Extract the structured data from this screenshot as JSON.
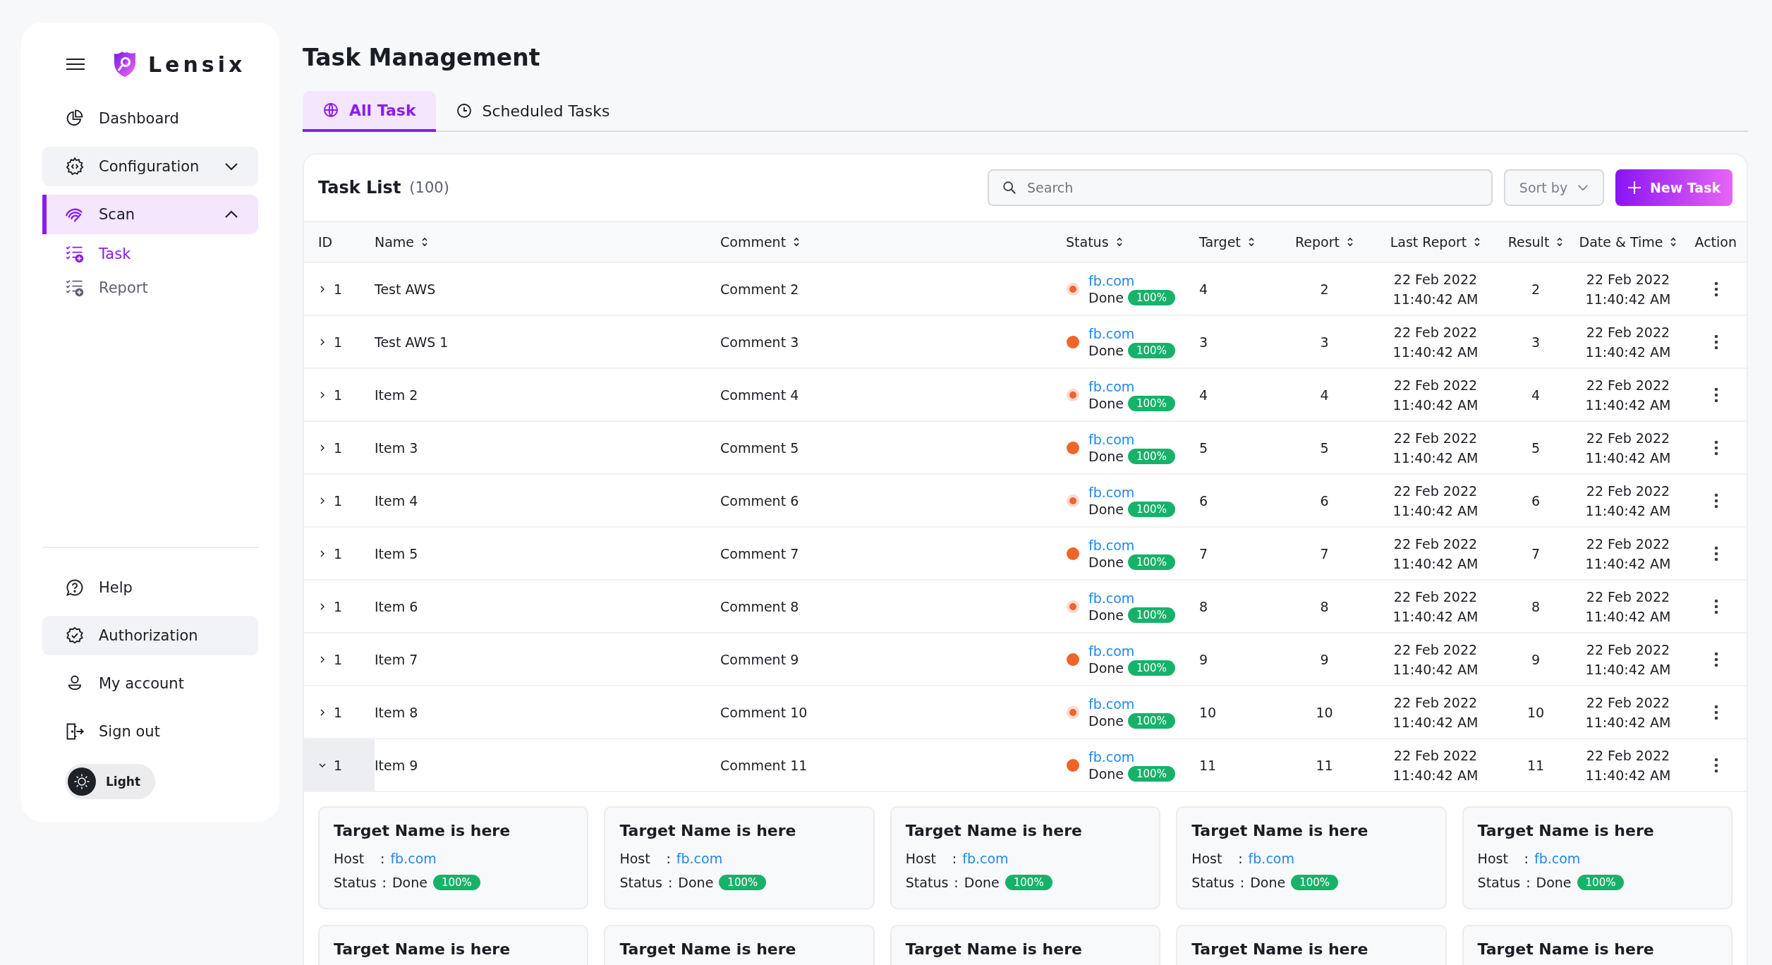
{
  "brand": "Lensix",
  "nav": [
    {
      "label": "Dashboard",
      "selected": false,
      "tinted": false
    },
    {
      "label": "Configuration",
      "selected": false,
      "expanded": false,
      "tinted": true
    },
    {
      "label": "Scan",
      "selected": true,
      "expanded": true,
      "children": [
        {
          "label": "Task",
          "selected": true
        },
        {
          "label": "Report",
          "selected": false
        }
      ]
    }
  ],
  "bottom_nav": [
    {
      "label": "Help",
      "tinted": false
    },
    {
      "label": "Authorization",
      "tinted": true
    },
    {
      "label": "My account",
      "tinted": false
    },
    {
      "label": "Sign out",
      "tinted": false
    }
  ],
  "theme_toggle": {
    "label": "Light",
    "on": false
  },
  "page_title": "Task Management",
  "tabs": [
    {
      "label": "All Task",
      "selected": true
    },
    {
      "label": "Scheduled Tasks",
      "selected": false
    }
  ],
  "task_list": {
    "title": "Task List",
    "count": "(100)",
    "search": {
      "placeholder": "Search"
    },
    "sort": {
      "placeholder": "Sort by"
    },
    "new_button": "New Task"
  },
  "columns": [
    {
      "label": "ID",
      "sortable": false
    },
    {
      "label": "Name",
      "sortable": true
    },
    {
      "label": "Comment",
      "sortable": true
    },
    {
      "label": "Status",
      "sortable": true
    },
    {
      "label": "Target",
      "sortable": true
    },
    {
      "label": "Report",
      "sortable": true
    },
    {
      "label": "Last Report",
      "sortable": true
    },
    {
      "label": "Result",
      "sortable": true
    },
    {
      "label": "Date & Time",
      "sortable": true
    },
    {
      "label": "Action",
      "sortable": false
    }
  ],
  "rows": [
    {
      "id": "1",
      "name": "Test AWS",
      "comment": "Comment 2",
      "host": "fb.com",
      "status": "Done",
      "progress": "100%",
      "pulsing": true,
      "target": "4",
      "report": "2",
      "last_report": [
        "22 Feb 2022",
        "11:40:42 AM"
      ],
      "result": "2",
      "date_time": [
        "22 Feb 2022",
        "11:40:42 AM"
      ],
      "expanded": false
    },
    {
      "id": "1",
      "name": "Test AWS 1",
      "comment": "Comment 3",
      "host": "fb.com",
      "status": "Done",
      "progress": "100%",
      "pulsing": false,
      "target": "3",
      "report": "3",
      "last_report": [
        "22 Feb 2022",
        "11:40:42 AM"
      ],
      "result": "3",
      "date_time": [
        "22 Feb 2022",
        "11:40:42 AM"
      ],
      "expanded": false
    },
    {
      "id": "1",
      "name": "Item 2",
      "comment": "Comment 4",
      "host": "fb.com",
      "status": "Done",
      "progress": "100%",
      "pulsing": true,
      "target": "4",
      "report": "4",
      "last_report": [
        "22 Feb 2022",
        "11:40:42 AM"
      ],
      "result": "4",
      "date_time": [
        "22 Feb 2022",
        "11:40:42 AM"
      ],
      "expanded": false
    },
    {
      "id": "1",
      "name": "Item 3",
      "comment": "Comment 5",
      "host": "fb.com",
      "status": "Done",
      "progress": "100%",
      "pulsing": false,
      "target": "5",
      "report": "5",
      "last_report": [
        "22 Feb 2022",
        "11:40:42 AM"
      ],
      "result": "5",
      "date_time": [
        "22 Feb 2022",
        "11:40:42 AM"
      ],
      "expanded": false
    },
    {
      "id": "1",
      "name": "Item 4",
      "comment": "Comment 6",
      "host": "fb.com",
      "status": "Done",
      "progress": "100%",
      "pulsing": true,
      "target": "6",
      "report": "6",
      "last_report": [
        "22 Feb 2022",
        "11:40:42 AM"
      ],
      "result": "6",
      "date_time": [
        "22 Feb 2022",
        "11:40:42 AM"
      ],
      "expanded": false
    },
    {
      "id": "1",
      "name": "Item 5",
      "comment": "Comment 7",
      "host": "fb.com",
      "status": "Done",
      "progress": "100%",
      "pulsing": false,
      "target": "7",
      "report": "7",
      "last_report": [
        "22 Feb 2022",
        "11:40:42 AM"
      ],
      "result": "7",
      "date_time": [
        "22 Feb 2022",
        "11:40:42 AM"
      ],
      "expanded": false
    },
    {
      "id": "1",
      "name": "Item 6",
      "comment": "Comment 8",
      "host": "fb.com",
      "status": "Done",
      "progress": "100%",
      "pulsing": true,
      "target": "8",
      "report": "8",
      "last_report": [
        "22 Feb 2022",
        "11:40:42 AM"
      ],
      "result": "8",
      "date_time": [
        "22 Feb 2022",
        "11:40:42 AM"
      ],
      "expanded": false
    },
    {
      "id": "1",
      "name": "Item 7",
      "comment": "Comment 9",
      "host": "fb.com",
      "status": "Done",
      "progress": "100%",
      "pulsing": false,
      "target": "9",
      "report": "9",
      "last_report": [
        "22 Feb 2022",
        "11:40:42 AM"
      ],
      "result": "9",
      "date_time": [
        "22 Feb 2022",
        "11:40:42 AM"
      ],
      "expanded": false
    },
    {
      "id": "1",
      "name": "Item 8",
      "comment": "Comment 10",
      "host": "fb.com",
      "status": "Done",
      "progress": "100%",
      "pulsing": true,
      "target": "10",
      "report": "10",
      "last_report": [
        "22 Feb 2022",
        "11:40:42 AM"
      ],
      "result": "10",
      "date_time": [
        "22 Feb 2022",
        "11:40:42 AM"
      ],
      "expanded": false
    },
    {
      "id": "1",
      "name": "Item 9",
      "comment": "Comment 11",
      "host": "fb.com",
      "status": "Done",
      "progress": "100%",
      "pulsing": false,
      "target": "11",
      "report": "11",
      "last_report": [
        "22 Feb 2022",
        "11:40:42 AM"
      ],
      "result": "11",
      "date_time": [
        "22 Feb 2022",
        "11:40:42 AM"
      ],
      "expanded": true,
      "targets": [
        {
          "title": "Target Name is here",
          "host_label": "Host",
          "host_sep": ":",
          "host": "fb.com",
          "status_label": "Status",
          "status_sep": ":",
          "status": "Done",
          "progress": "100%"
        },
        {
          "title": "Target Name is here",
          "host_label": "Host",
          "host_sep": ":",
          "host": "fb.com",
          "status_label": "Status",
          "status_sep": ":",
          "status": "Done",
          "progress": "100%"
        },
        {
          "title": "Target Name is here",
          "host_label": "Host",
          "host_sep": ":",
          "host": "fb.com",
          "status_label": "Status",
          "status_sep": ":",
          "status": "Done",
          "progress": "100%"
        },
        {
          "title": "Target Name is here",
          "host_label": "Host",
          "host_sep": ":",
          "host": "fb.com",
          "status_label": "Status",
          "status_sep": ":",
          "status": "Done",
          "progress": "100%"
        },
        {
          "title": "Target Name is here",
          "host_label": "Host",
          "host_sep": ":",
          "host": "fb.com",
          "status_label": "Status",
          "status_sep": ":",
          "status": "Done",
          "progress": "100%"
        },
        {
          "title": "Target Name is here"
        },
        {
          "title": "Target Name is here"
        },
        {
          "title": "Target Name is here"
        },
        {
          "title": "Target Name is here"
        },
        {
          "title": "Target Name is here"
        }
      ]
    }
  ]
}
